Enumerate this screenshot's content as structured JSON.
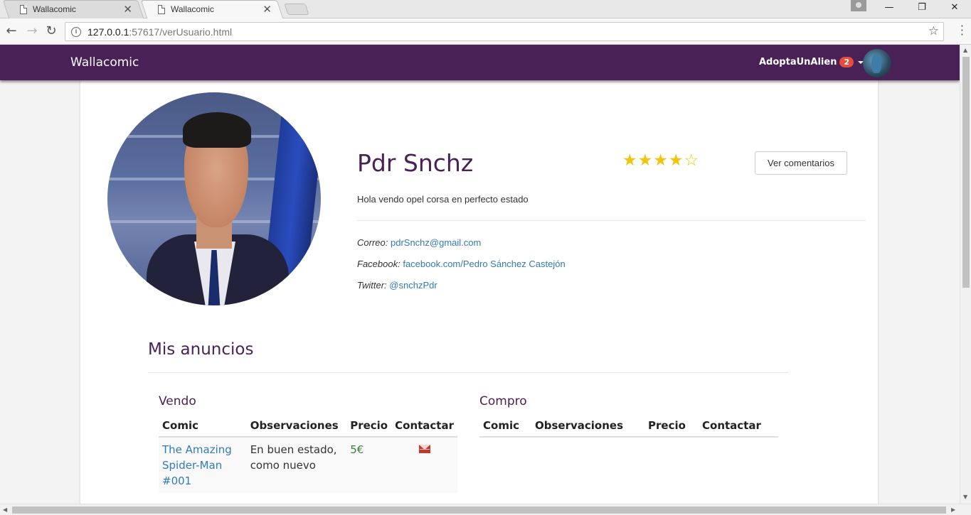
{
  "browser": {
    "tabs": [
      {
        "title": "Wallacomic",
        "active": false
      },
      {
        "title": "Wallacomic",
        "active": true
      }
    ],
    "url_host": "127.0.0.1",
    "url_rest": ":57617/verUsuario.html"
  },
  "navbar": {
    "brand": "Wallacomic",
    "username": "AdoptaUnAlien",
    "notification_count": "2"
  },
  "profile": {
    "name": "Pdr Snchz",
    "rating_stars": "★★★★☆",
    "rating_value": 4,
    "rating_max": 5,
    "comments_button": "Ver comentarios",
    "description": "Hola vendo opel corsa en perfecto estado",
    "contacts": [
      {
        "label": "Correo:",
        "value": "pdrSnchz@gmail.com"
      },
      {
        "label": "Facebook:",
        "value": "facebook.com/Pedro Sánchez Castejón"
      },
      {
        "label": "Twitter:",
        "value": "@snchzPdr"
      }
    ]
  },
  "ads": {
    "title": "Mis anuncios",
    "sell": {
      "title": "Vendo",
      "headers": [
        "Comic",
        "Observaciones",
        "Precio",
        "Contactar"
      ],
      "rows": [
        {
          "comic": "The Amazing Spider-Man #001",
          "notes": "En buen estado, como nuevo",
          "price": "5€",
          "contact_icon": "mail-icon"
        }
      ]
    },
    "buy": {
      "title": "Compro",
      "headers": [
        "Comic",
        "Observaciones",
        "Precio",
        "Contactar"
      ],
      "rows": []
    }
  },
  "colors": {
    "brand_purple": "#4a2157",
    "star_gold": "#f1c40f",
    "badge_red": "#e74c3c",
    "link_blue": "#337ab7",
    "mail_red": "#c0392b"
  }
}
